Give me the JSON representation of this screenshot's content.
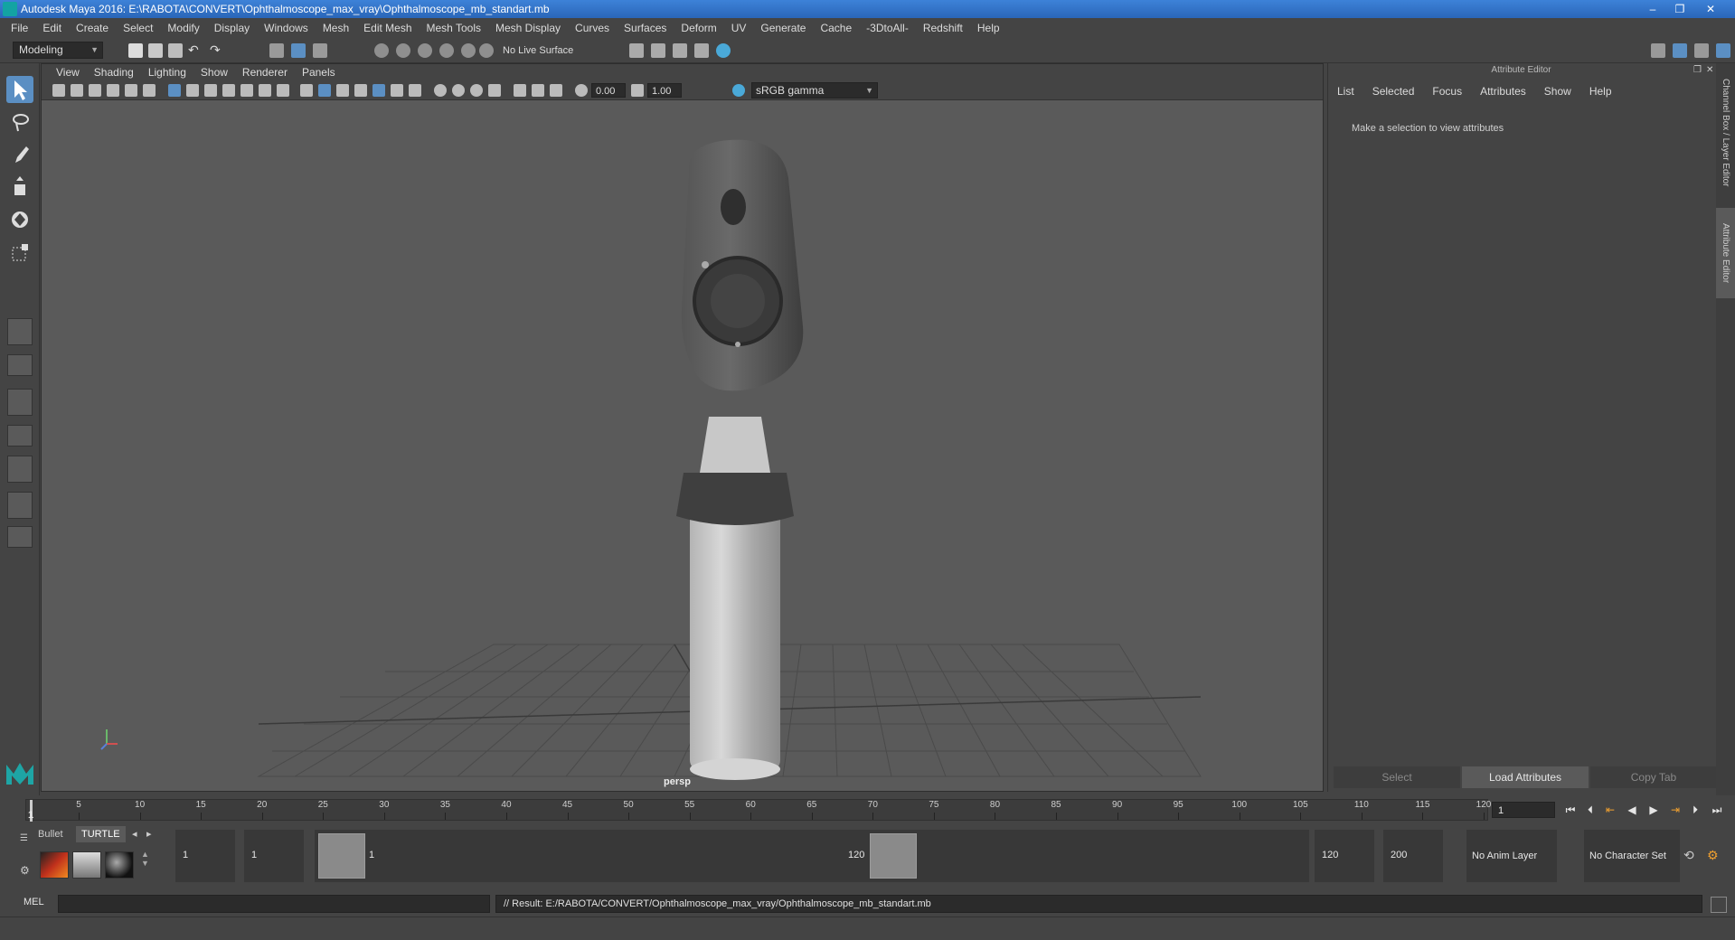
{
  "window": {
    "title": "Autodesk Maya 2016: E:\\RABOTA\\CONVERT\\Ophthalmoscope_max_vray\\Ophthalmoscope_mb_standart.mb",
    "minimize_label": "–",
    "maximize_label": "❐",
    "close_label": "✕"
  },
  "menubar": {
    "items": [
      "File",
      "Edit",
      "Create",
      "Select",
      "Modify",
      "Display",
      "Windows",
      "Mesh",
      "Edit Mesh",
      "Mesh Tools",
      "Mesh Display",
      "Curves",
      "Surfaces",
      "Deform",
      "UV",
      "Generate",
      "Cache",
      "-3DtoAll-",
      "Redshift",
      "Help"
    ]
  },
  "shelf": {
    "mode": "Modeling",
    "live_surface": "No Live Surface"
  },
  "viewport": {
    "menu": [
      "View",
      "Shading",
      "Lighting",
      "Show",
      "Renderer",
      "Panels"
    ],
    "exposure": "0.00",
    "gamma_value": "1.00",
    "color_space": "sRGB gamma",
    "camera_label": "persp"
  },
  "attribute_editor": {
    "title": "Attribute Editor",
    "menu": [
      "List",
      "Selected",
      "Focus",
      "Attributes",
      "Show",
      "Help"
    ],
    "message": "Make a selection to view attributes",
    "buttons": {
      "select": "Select",
      "load": "Load Attributes",
      "copy_tab": "Copy Tab"
    }
  },
  "side_tabs": {
    "channel_box": "Channel Box / Layer Editor",
    "attribute_editor": "Attribute Editor"
  },
  "time_slider": {
    "ticks": [
      "5",
      "10",
      "15",
      "20",
      "25",
      "30",
      "35",
      "40",
      "45",
      "50",
      "55",
      "60",
      "65",
      "70",
      "75",
      "80",
      "85",
      "90",
      "95",
      "100",
      "105",
      "110",
      "115",
      "120"
    ],
    "current_frame_marker": "1",
    "current_frame": "1",
    "range_min": 1,
    "range_max": 120,
    "current_value": 1
  },
  "range_slider": {
    "shelf_tabs": [
      "Bullet",
      "TURTLE"
    ],
    "start_time": "1",
    "playback_start": "1",
    "range_start_label": "1",
    "range_end_label": "120",
    "playback_end": "120",
    "end_time": "200",
    "anim_layer": "No Anim Layer",
    "character_set": "No Character Set"
  },
  "command_line": {
    "label": "MEL",
    "result": "// Result: E:/RABOTA/CONVERT/Ophthalmoscope_max_vray/Ophthalmoscope_mb_standart.mb"
  },
  "colors": {
    "panel_bg": "#444444",
    "viewport_bg": "#5a5a5a",
    "selection_accent": "#5b8fc3",
    "title_bar": "#2a66b8"
  }
}
